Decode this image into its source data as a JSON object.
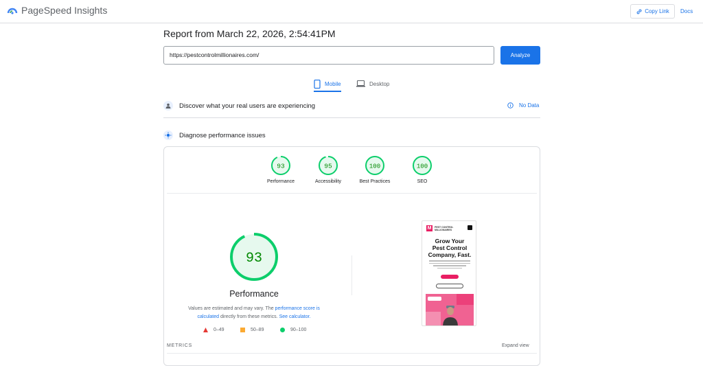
{
  "app": {
    "name": "PageSpeed Insights"
  },
  "header": {
    "copy_link": "Copy Link",
    "docs": "Docs"
  },
  "report": {
    "title": "Report from March 22, 2026, 2:54:41PM",
    "url_value": "https://pestcontrolmillionaires.com/",
    "analyze_label": "Analyze"
  },
  "tabs": [
    {
      "label": "Mobile",
      "active": true,
      "icon": "phone-icon"
    },
    {
      "label": "Desktop",
      "active": false,
      "icon": "laptop-icon"
    }
  ],
  "field_data": {
    "title": "Discover what your real users are experiencing",
    "status": "No Data"
  },
  "diagnose": {
    "title": "Diagnose performance issues"
  },
  "scores": [
    {
      "value": "93",
      "label": "Performance"
    },
    {
      "value": "95",
      "label": "Accessibility"
    },
    {
      "value": "100",
      "label": "Best Practices"
    },
    {
      "value": "100",
      "label": "SEO"
    }
  ],
  "performance": {
    "score": "93",
    "title": "Performance",
    "note_1": "Values are estimated and may vary. The ",
    "note_link_1": "performance score is calculated",
    "note_2": " directly from these metrics. ",
    "note_link_2": "See calculator."
  },
  "legend": [
    {
      "range": "0–49",
      "color": "#e53935"
    },
    {
      "range": "50–89",
      "color": "#fbaa33"
    },
    {
      "range": "90–100",
      "color": "#0cce6b"
    }
  ],
  "metrics": {
    "label": "METRICS",
    "expand": "Expand view"
  },
  "screenshot": {
    "headline_1": "Grow Your",
    "headline_2": "Pest Control",
    "headline_3": "Company, Fast.",
    "brand_1": "PEST CONTROL",
    "brand_2": "MILLIONAIRES",
    "logo_letter": "M"
  },
  "colors": {
    "accent": "#1a73e8",
    "pass": "#0cce6b",
    "pass_text": "#008800"
  }
}
